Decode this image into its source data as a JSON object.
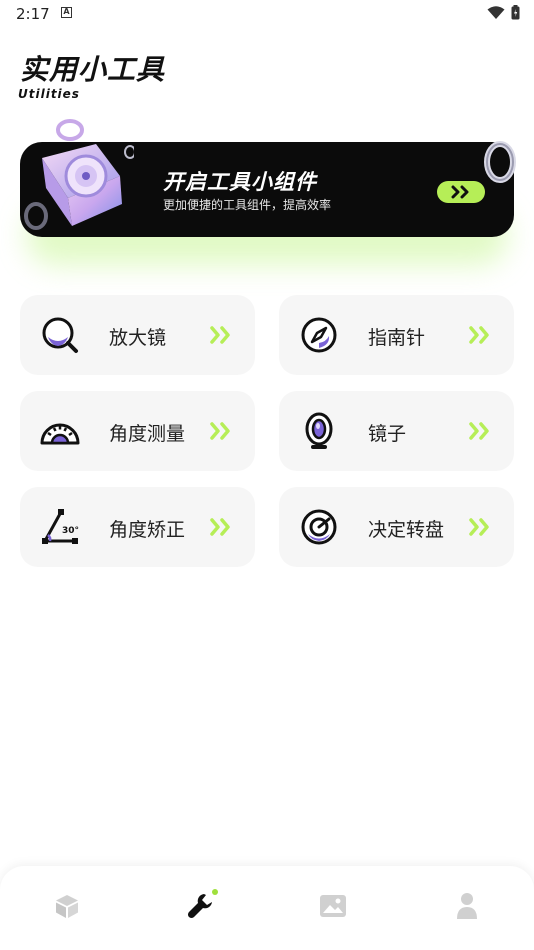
{
  "status_bar": {
    "time": "2:17",
    "notification_letter": "A"
  },
  "header": {
    "title": "实用小工具",
    "subtitle": "Utilities"
  },
  "banner": {
    "title": "开启工具小组件",
    "description": "更加便捷的工具组件，提高效率",
    "button_icon": "double-chevron-right-icon",
    "accent": "#b6ee57"
  },
  "tools": [
    {
      "label": "放大镜",
      "icon": "magnifier-icon"
    },
    {
      "label": "指南针",
      "icon": "compass-icon"
    },
    {
      "label": "角度测量",
      "icon": "protractor-icon"
    },
    {
      "label": "镜子",
      "icon": "mirror-icon"
    },
    {
      "label": "角度矫正",
      "icon": "angle-correction-icon",
      "icon_text": "30°"
    },
    {
      "label": "决定转盘",
      "icon": "spinner-wheel-icon"
    }
  ],
  "bottom_nav": {
    "items": [
      {
        "icon": "cube-icon",
        "active": false
      },
      {
        "icon": "wrench-icon",
        "active": true
      },
      {
        "icon": "image-icon",
        "active": false
      },
      {
        "icon": "person-icon",
        "active": false
      }
    ],
    "active_color": "#111111",
    "inactive_color": "#d0d0d0",
    "indicator_color": "#9fe03c"
  }
}
